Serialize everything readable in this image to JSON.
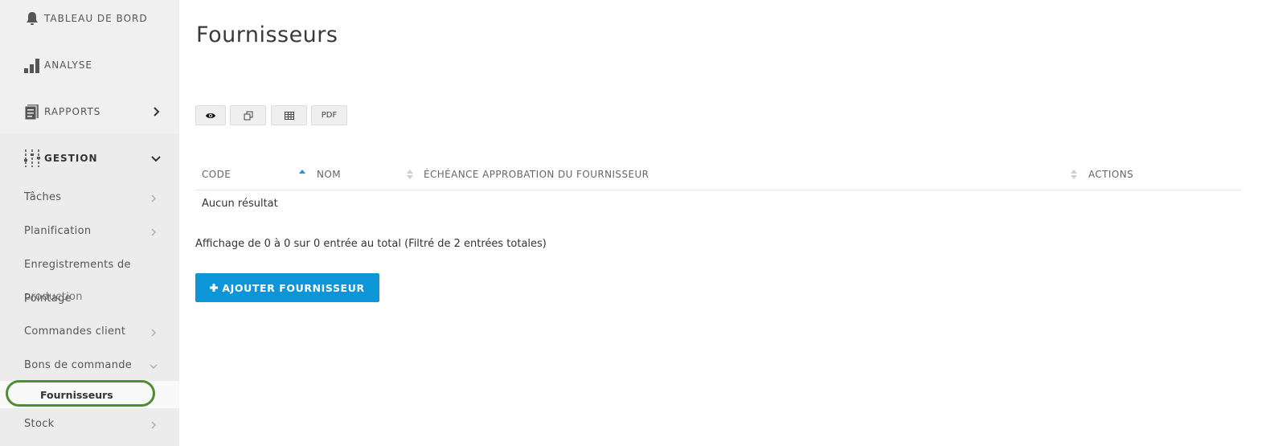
{
  "sidebar": {
    "top": [
      {
        "label": "TABLEAU DE BORD",
        "icon": "bell-icon"
      },
      {
        "label": "ANALYSE",
        "icon": "bar-chart-icon"
      },
      {
        "label": "RAPPORTS",
        "icon": "document-icon"
      },
      {
        "label": "GESTION",
        "icon": "sliders-icon"
      }
    ],
    "items": [
      {
        "label": "Tâches"
      },
      {
        "label": "Planification"
      },
      {
        "label": "Enregistrements de"
      },
      {
        "label": "production"
      },
      {
        "label": "Pointage"
      },
      {
        "label": "Commandes client"
      },
      {
        "label": "Bons de commande"
      },
      {
        "label": "Fournisseurs"
      },
      {
        "label": "Stock"
      }
    ]
  },
  "page": {
    "title": "Fournisseurs"
  },
  "toolbar": {
    "pdf_label": "PDF"
  },
  "table": {
    "columns": [
      "CODE",
      "NOM",
      "ÉCHÉANCE APPROBATION DU FOURNISSEUR",
      "ACTIONS"
    ],
    "empty_text": "Aucun résultat",
    "info_text": "Affichage de 0 à 0 sur 0 entrée au total (Filtré de 2 entrées totales)"
  },
  "actions": {
    "add_label": "AJOUTER FOURNISSEUR"
  },
  "colors": {
    "accent": "#0c96d8",
    "highlight": "#4e8d34",
    "sort_active": "#1a9ad6"
  }
}
